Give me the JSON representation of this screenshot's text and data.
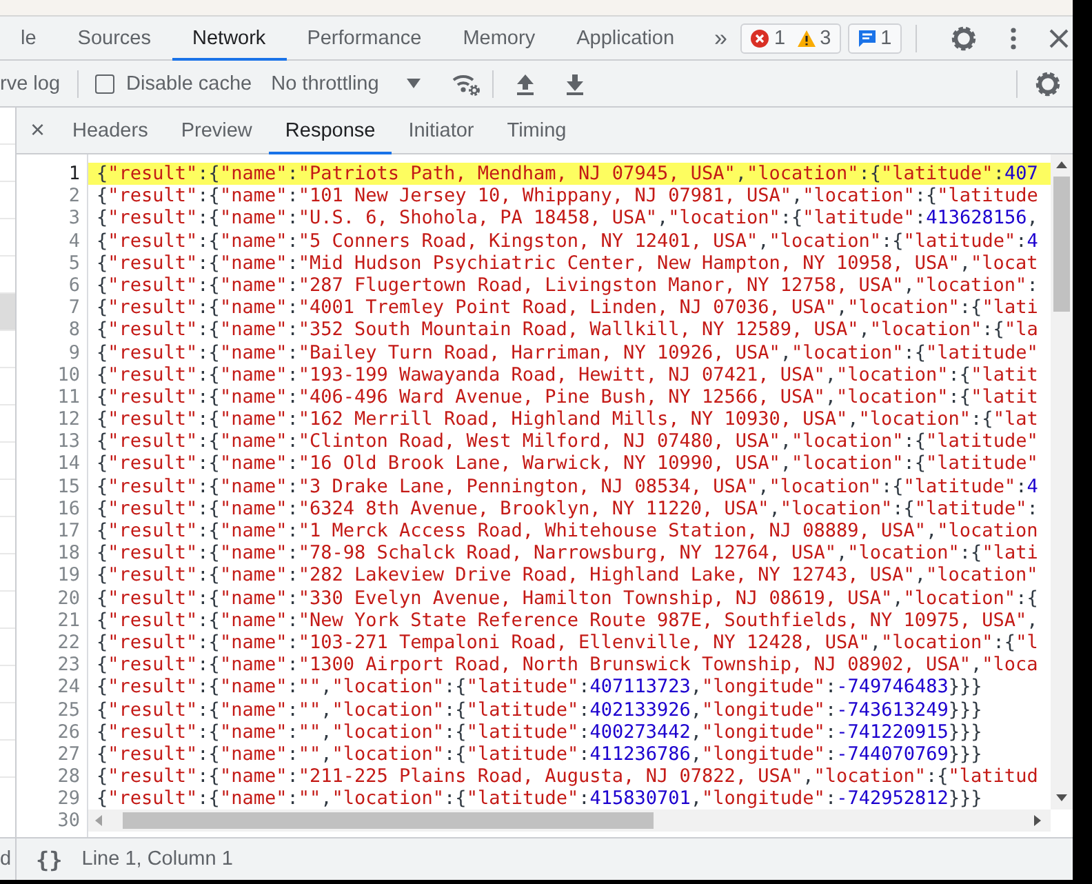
{
  "main_tabs": {
    "items": [
      {
        "label": "le",
        "selected": false
      },
      {
        "label": "Sources",
        "selected": false
      },
      {
        "label": "Network",
        "selected": true
      },
      {
        "label": "Performance",
        "selected": false
      },
      {
        "label": "Memory",
        "selected": false
      },
      {
        "label": "Application",
        "selected": false
      }
    ],
    "more": "»",
    "badge_groups": [
      {
        "items": [
          {
            "kind": "error",
            "count": "1"
          },
          {
            "kind": "warning",
            "count": "3"
          }
        ]
      },
      {
        "items": [
          {
            "kind": "message",
            "count": "1"
          }
        ]
      }
    ]
  },
  "network_toolbar": {
    "preserve_log_label": "rve log",
    "disable_cache": {
      "label": "Disable cache",
      "checked": false
    },
    "throttling": {
      "value": "No throttling"
    }
  },
  "request_list": {
    "rows": [
      {
        "selected": false
      },
      {
        "selected": false
      },
      {
        "selected": false
      },
      {
        "selected": false
      },
      {
        "selected": false
      },
      {
        "selected": true
      },
      {
        "selected": false
      },
      {
        "selected": false
      },
      {
        "selected": false
      },
      {
        "selected": false
      },
      {
        "selected": false
      },
      {
        "selected": false
      },
      {
        "selected": false
      },
      {
        "selected": false
      },
      {
        "selected": false
      },
      {
        "selected": false
      },
      {
        "selected": false
      },
      {
        "selected": false
      }
    ]
  },
  "detail_tabs": {
    "close": "×",
    "items": [
      {
        "label": "Headers",
        "selected": false
      },
      {
        "label": "Preview",
        "selected": false
      },
      {
        "label": "Response",
        "selected": true
      },
      {
        "label": "Initiator",
        "selected": false
      },
      {
        "label": "Timing",
        "selected": false
      }
    ]
  },
  "editor": {
    "lines": [
      {
        "number": "1",
        "code": "{\"result\":{\"name\":\"Patriots Path, Mendham, NJ 07945, USA\",\"location\":{\"latitude\":407",
        "current": true
      },
      {
        "number": "2",
        "code": "{\"result\":{\"name\":\"101 New Jersey 10, Whippany, NJ 07981, USA\",\"location\":{\"latitude",
        "current": false
      },
      {
        "number": "3",
        "code": "{\"result\":{\"name\":\"U.S. 6, Shohola, PA 18458, USA\",\"location\":{\"latitude\":413628156,",
        "current": false
      },
      {
        "number": "4",
        "code": "{\"result\":{\"name\":\"5 Conners Road, Kingston, NY 12401, USA\",\"location\":{\"latitude\":4",
        "current": false
      },
      {
        "number": "5",
        "code": "{\"result\":{\"name\":\"Mid Hudson Psychiatric Center, New Hampton, NY 10958, USA\",\"locat",
        "current": false
      },
      {
        "number": "6",
        "code": "{\"result\":{\"name\":\"287 Flugertown Road, Livingston Manor, NY 12758, USA\",\"location\":",
        "current": false
      },
      {
        "number": "7",
        "code": "{\"result\":{\"name\":\"4001 Tremley Point Road, Linden, NJ 07036, USA\",\"location\":{\"lati",
        "current": false
      },
      {
        "number": "8",
        "code": "{\"result\":{\"name\":\"352 South Mountain Road, Wallkill, NY 12589, USA\",\"location\":{\"la",
        "current": false
      },
      {
        "number": "9",
        "code": "{\"result\":{\"name\":\"Bailey Turn Road, Harriman, NY 10926, USA\",\"location\":{\"latitude\"",
        "current": false
      },
      {
        "number": "10",
        "code": "{\"result\":{\"name\":\"193-199 Wawayanda Road, Hewitt, NJ 07421, USA\",\"location\":{\"latit",
        "current": false
      },
      {
        "number": "11",
        "code": "{\"result\":{\"name\":\"406-496 Ward Avenue, Pine Bush, NY 12566, USA\",\"location\":{\"latit",
        "current": false
      },
      {
        "number": "12",
        "code": "{\"result\":{\"name\":\"162 Merrill Road, Highland Mills, NY 10930, USA\",\"location\":{\"lat",
        "current": false
      },
      {
        "number": "13",
        "code": "{\"result\":{\"name\":\"Clinton Road, West Milford, NJ 07480, USA\",\"location\":{\"latitude\"",
        "current": false
      },
      {
        "number": "14",
        "code": "{\"result\":{\"name\":\"16 Old Brook Lane, Warwick, NY 10990, USA\",\"location\":{\"latitude\"",
        "current": false
      },
      {
        "number": "15",
        "code": "{\"result\":{\"name\":\"3 Drake Lane, Pennington, NJ 08534, USA\",\"location\":{\"latitude\":4",
        "current": false
      },
      {
        "number": "16",
        "code": "{\"result\":{\"name\":\"6324 8th Avenue, Brooklyn, NY 11220, USA\",\"location\":{\"latitude\":",
        "current": false
      },
      {
        "number": "17",
        "code": "{\"result\":{\"name\":\"1 Merck Access Road, Whitehouse Station, NJ 08889, USA\",\"location",
        "current": false
      },
      {
        "number": "18",
        "code": "{\"result\":{\"name\":\"78-98 Schalck Road, Narrowsburg, NY 12764, USA\",\"location\":{\"lati",
        "current": false
      },
      {
        "number": "19",
        "code": "{\"result\":{\"name\":\"282 Lakeview Drive Road, Highland Lake, NY 12743, USA\",\"location\"",
        "current": false
      },
      {
        "number": "20",
        "code": "{\"result\":{\"name\":\"330 Evelyn Avenue, Hamilton Township, NJ 08619, USA\",\"location\":{",
        "current": false
      },
      {
        "number": "21",
        "code": "{\"result\":{\"name\":\"New York State Reference Route 987E, Southfields, NY 10975, USA\",",
        "current": false
      },
      {
        "number": "22",
        "code": "{\"result\":{\"name\":\"103-271 Tempaloni Road, Ellenville, NY 12428, USA\",\"location\":{\"l",
        "current": false
      },
      {
        "number": "23",
        "code": "{\"result\":{\"name\":\"1300 Airport Road, North Brunswick Township, NJ 08902, USA\",\"loca",
        "current": false
      },
      {
        "number": "24",
        "code": "{\"result\":{\"name\":\"\",\"location\":{\"latitude\":407113723,\"longitude\":-749746483}}}",
        "current": false
      },
      {
        "number": "25",
        "code": "{\"result\":{\"name\":\"\",\"location\":{\"latitude\":402133926,\"longitude\":-743613249}}}",
        "current": false
      },
      {
        "number": "26",
        "code": "{\"result\":{\"name\":\"\",\"location\":{\"latitude\":400273442,\"longitude\":-741220915}}}",
        "current": false
      },
      {
        "number": "27",
        "code": "{\"result\":{\"name\":\"\",\"location\":{\"latitude\":411236786,\"longitude\":-744070769}}}",
        "current": false
      },
      {
        "number": "28",
        "code": "{\"result\":{\"name\":\"211-225 Plains Road, Augusta, NJ 07822, USA\",\"location\":{\"latitud",
        "current": false
      },
      {
        "number": "29",
        "code": "{\"result\":{\"name\":\"\",\"location\":{\"latitude\":415830701,\"longitude\":-742952812}}}",
        "current": false
      },
      {
        "number": "30",
        "current": false
      }
    ]
  },
  "status_bar": {
    "left_text": "d",
    "format_button": "{}",
    "position": "Line 1, Column 1"
  }
}
